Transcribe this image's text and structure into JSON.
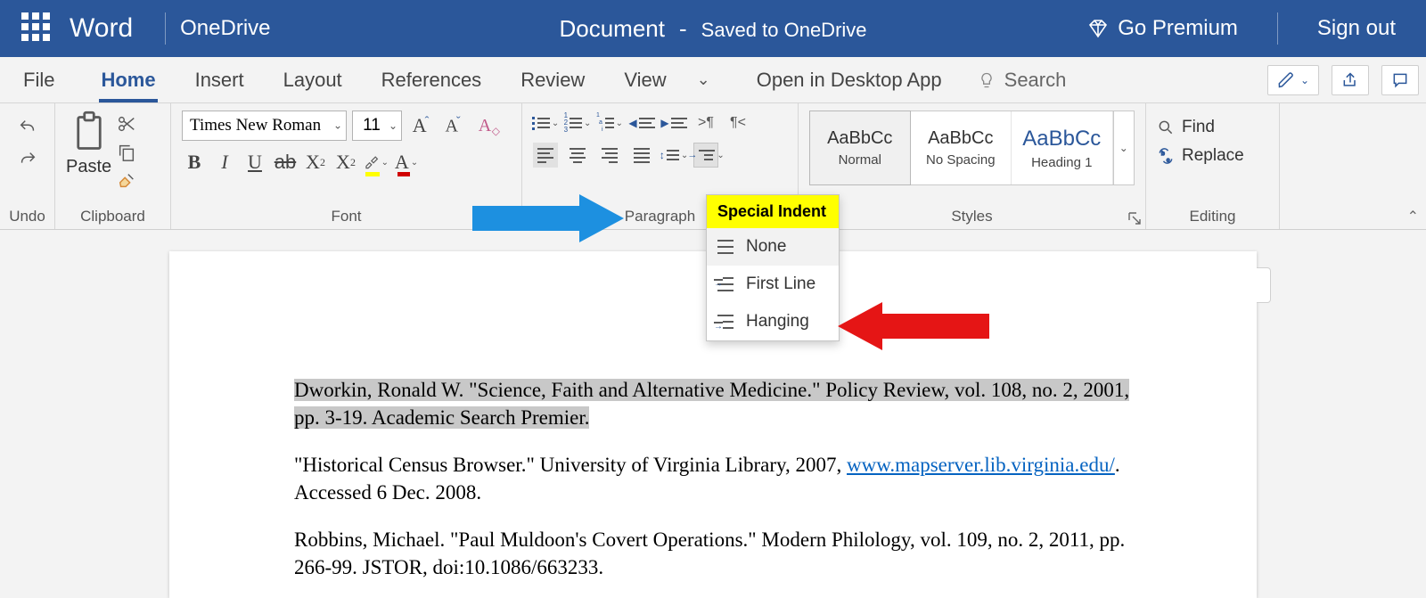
{
  "titlebar": {
    "app": "Word",
    "location": "OneDrive",
    "docname": "Document",
    "dash": "-",
    "saved_status": "Saved to OneDrive",
    "go_premium": "Go Premium",
    "sign_out": "Sign out"
  },
  "tabs": {
    "file": "File",
    "home": "Home",
    "insert": "Insert",
    "layout": "Layout",
    "references": "References",
    "review": "Review",
    "view": "View",
    "open_desktop": "Open in Desktop App",
    "search_placeholder": "Search"
  },
  "ribbon": {
    "undo_label": "Undo",
    "clipboard": {
      "label": "Clipboard",
      "paste": "Paste"
    },
    "font": {
      "label": "Font",
      "font_name": "Times New Roman",
      "font_size": "11"
    },
    "paragraph": {
      "label": "Paragraph"
    },
    "styles": {
      "label": "Styles",
      "cards": [
        {
          "sample": "AaBbCc",
          "name": "Normal"
        },
        {
          "sample": "AaBbCc",
          "name": "No Spacing"
        },
        {
          "sample": "AaBbCc",
          "name": "Heading 1"
        }
      ]
    },
    "editing": {
      "label": "Editing",
      "find": "Find",
      "replace": "Replace"
    }
  },
  "dropdown": {
    "header": "Special Indent",
    "items": [
      "None",
      "First Line",
      "Hanging"
    ]
  },
  "document": {
    "p1_sel_l1": "Dworkin, Ronald W. \"Science, Faith and Alternative Medicine.\" Policy Review, vol. 108, no. 2, 2001,",
    "p1_sel_l2": "pp. 3-19. Academic Search Premier.",
    "p2_a": "\"Historical Census Browser.\" University of Virginia Library, 2007, ",
    "p2_link": "www.mapserver.lib.virginia.edu/",
    "p2_b": ". Accessed 6 Dec. 2008.",
    "p3": "Robbins, Michael. \"Paul Muldoon's Covert Operations.\" Modern Philology, vol. 109, no. 2, 2011, pp. 266-99. JSTOR, doi:10.1086/663233."
  }
}
